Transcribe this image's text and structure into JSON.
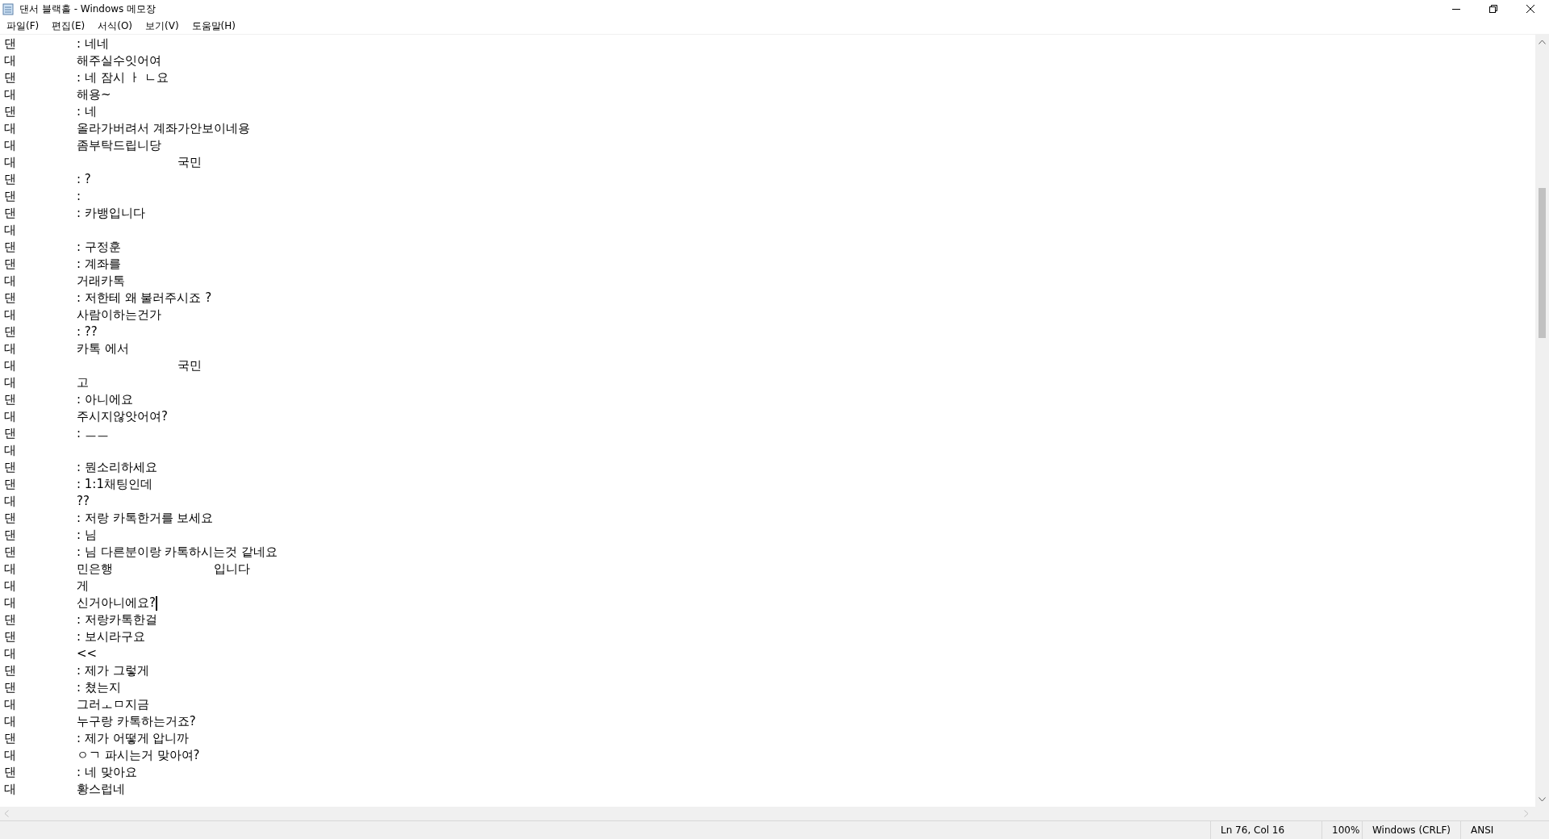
{
  "window": {
    "title": "댄서 블랙홀 - Windows 메모장"
  },
  "menu": [
    "파일(F)",
    "편집(E)",
    "서식(O)",
    "보기(V)",
    "도움말(H)"
  ],
  "lines": [
    {
      "speaker": "댄",
      "text": ": 네네"
    },
    {
      "speaker": "대",
      "text": "해주실수잇어여"
    },
    {
      "speaker": "댄",
      "text": ": 네 잠시 ㅏ ㄴ요"
    },
    {
      "speaker": "대",
      "text": "해용~"
    },
    {
      "speaker": "댄",
      "text": ": 네"
    },
    {
      "speaker": "대",
      "text": "올라가버려서 계좌가안보이네용"
    },
    {
      "speaker": "대",
      "text": "좀부탁드립니당"
    },
    {
      "speaker": "대",
      "after_redaction": "국민"
    },
    {
      "speaker": "댄",
      "text": ": ?"
    },
    {
      "speaker": "댄",
      "text": ":"
    },
    {
      "speaker": "댄",
      "text": ": 카뱅입니다"
    },
    {
      "speaker": "대"
    },
    {
      "speaker": "댄",
      "text": ": 구정훈"
    },
    {
      "speaker": "댄",
      "text": ": 계좌를"
    },
    {
      "speaker": "대",
      "text": "거래카톡"
    },
    {
      "speaker": "댄",
      "text": ": 저한테 왜 불러주시죠 ?"
    },
    {
      "speaker": "대",
      "text": "사람이하는건가"
    },
    {
      "speaker": "댄",
      "text": ": ??"
    },
    {
      "speaker": "대",
      "text": "카톡 에서"
    },
    {
      "speaker": "대",
      "after_redaction": "국민"
    },
    {
      "speaker": "대",
      "text": "고"
    },
    {
      "speaker": "댄",
      "text": ": 아니에요"
    },
    {
      "speaker": "대",
      "text": "주시지않앗어여?"
    },
    {
      "speaker": "댄",
      "text": ": ㅡㅡ"
    },
    {
      "speaker": "대"
    },
    {
      "speaker": "댄",
      "text": ": 뭔소리하세요"
    },
    {
      "speaker": "댄",
      "text": ": 1:1채팅인데"
    },
    {
      "speaker": "대",
      "text": "??"
    },
    {
      "speaker": "댄",
      "text": ": 저랑 카톡한거를 보세요"
    },
    {
      "speaker": "댄",
      "text": ": 님"
    },
    {
      "speaker": "댄",
      "text": ": 님 다른분이랑 카톡하시는것 같네요"
    },
    {
      "speaker": "대",
      "text": "민은행",
      "after_redaction": "입니다"
    },
    {
      "speaker": "대",
      "text": "게"
    },
    {
      "speaker": "대",
      "text": "신거아니에요?",
      "caret": true
    },
    {
      "speaker": "댄",
      "text": ": 저랑카톡한걸"
    },
    {
      "speaker": "댄",
      "text": ": 보시라구요"
    },
    {
      "speaker": "대",
      "text": "<<"
    },
    {
      "speaker": "댄",
      "text": ": 제가 그렇게"
    },
    {
      "speaker": "댄",
      "text": ": 쳤는지"
    },
    {
      "speaker": "대",
      "text": "그러ㅗㅁ지금"
    },
    {
      "speaker": "대",
      "text": "누구랑 카톡하는거죠?"
    },
    {
      "speaker": "댄",
      "text": ": 제가 어떻게 압니까"
    },
    {
      "speaker": "대",
      "text": "ㅇㄱ 파시는거 맞아여?"
    },
    {
      "speaker": "댄",
      "text": ": 네 맞아요"
    },
    {
      "speaker": "대",
      "text": "황스럽네"
    }
  ],
  "status_bar": {
    "position": "Ln 76, Col 16",
    "zoom": "100%",
    "line_ending": "Windows (CRLF)",
    "encoding": "ANSI"
  }
}
